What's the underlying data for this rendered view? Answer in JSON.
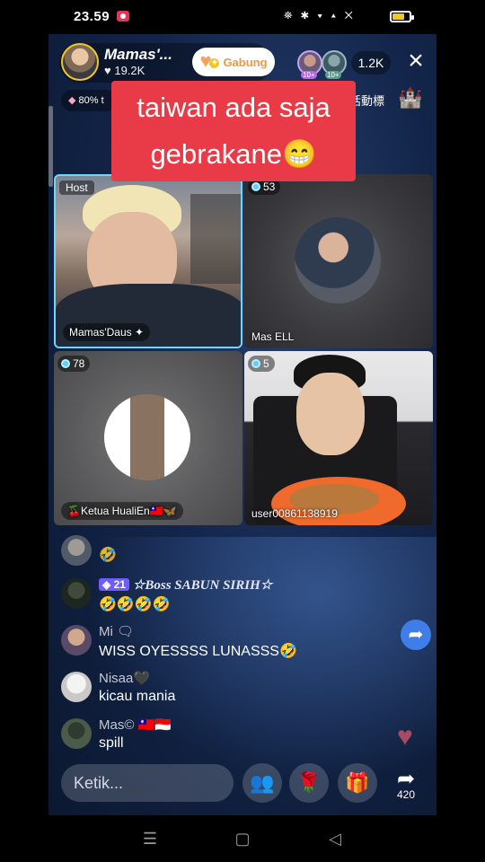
{
  "status_bar": {
    "time": "23.59",
    "icons": "⛯ ✱ ▾ ▴ ✕",
    "battery_level": 0.7,
    "battery_color": "#f3c623"
  },
  "host": {
    "name": "Mamas'...",
    "likes": "19.2K",
    "join_label": "Gabung",
    "viewer_count": "1.2K",
    "viewer_levels": [
      "10+",
      "10+"
    ]
  },
  "rank_badge": "80% t",
  "event_tag": "活動標",
  "caption": {
    "line1": "taiwan ada saja",
    "line2": "gebrakane😁"
  },
  "tiles": [
    {
      "tag": "Host",
      "label": "Mamas'Daus ✦"
    },
    {
      "score": "53",
      "label": "Mas ELL"
    },
    {
      "score": "78",
      "label": "🍒Ketua HualiEn🇹🇼🦋"
    },
    {
      "score": "5",
      "label": "user00861138919"
    }
  ],
  "chat": [
    {
      "name": "",
      "message": "🤣"
    },
    {
      "level": "21",
      "name": "☆Boss SABUN SIRIH☆",
      "message": "🤣🤣🤣🤣"
    },
    {
      "name": "Mi 🗨",
      "message": "WISS OYESSSS LUNASSS🤣"
    },
    {
      "name": "Nisaa🖤",
      "message": "kicau mania"
    },
    {
      "name": "Mas© 🇹🇼🇮🇩",
      "message": "spill"
    }
  ],
  "composer": {
    "placeholder": "Ketik...",
    "share_count": "420"
  },
  "colors": {
    "caption_bg": "#e93b47",
    "accent_gold": "#f3c623",
    "share_blue": "#3f7ee8"
  }
}
